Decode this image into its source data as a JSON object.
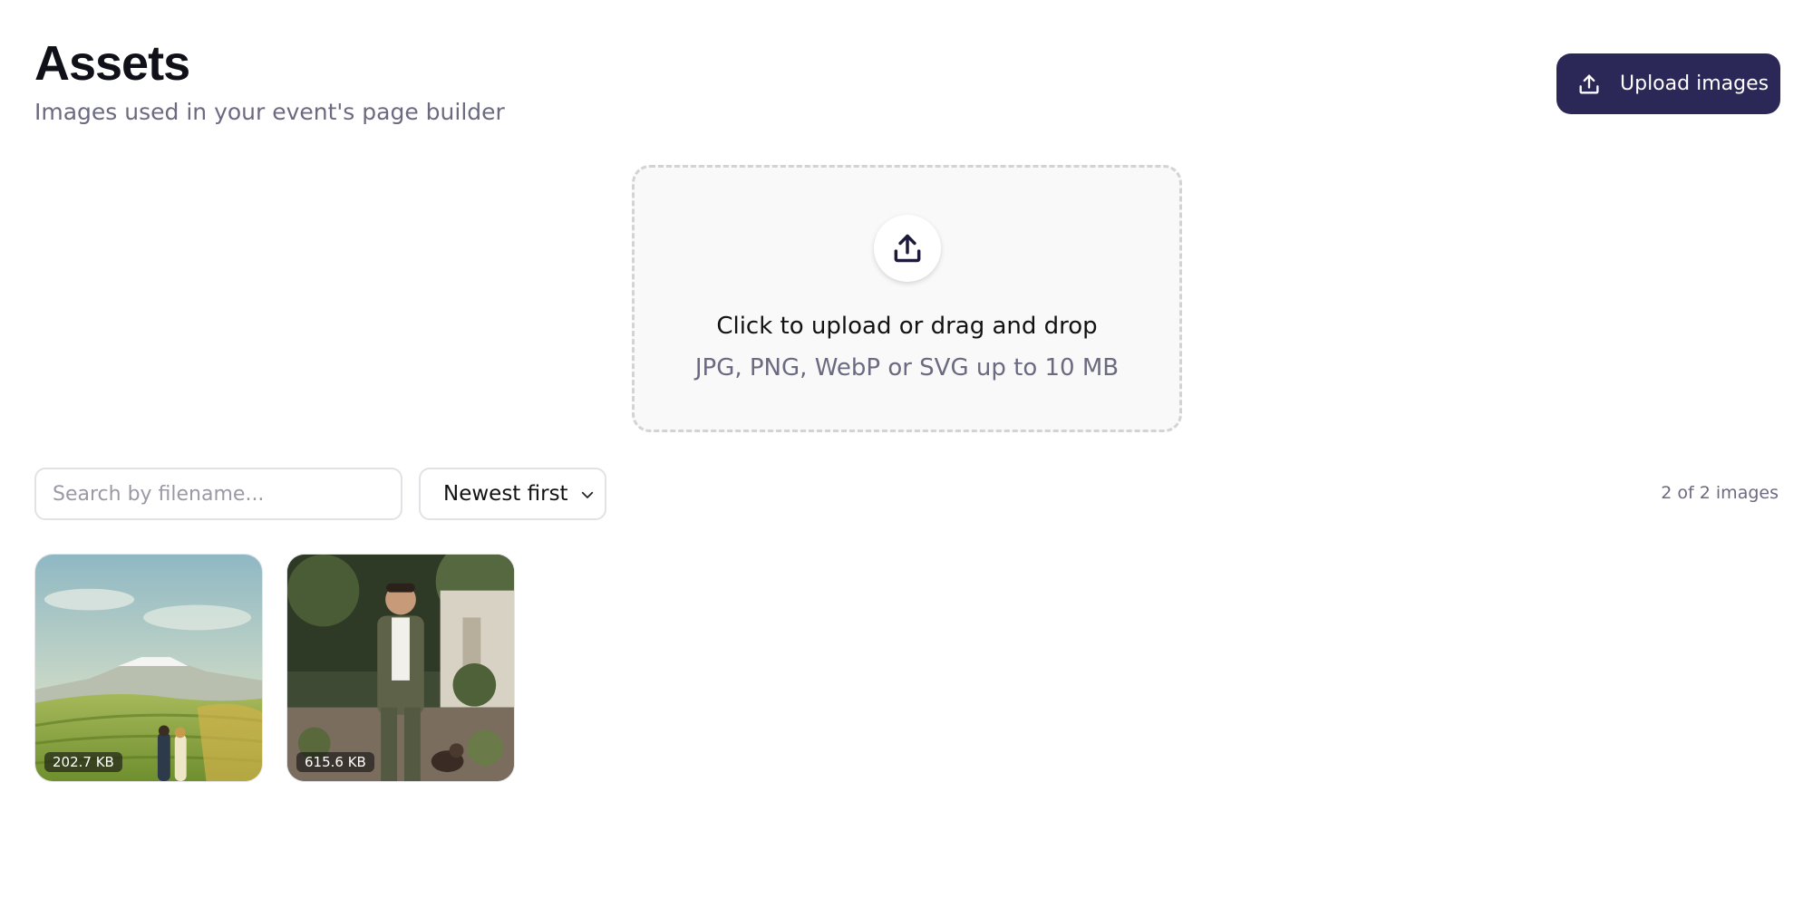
{
  "header": {
    "title": "Assets",
    "subtitle": "Images used in your event's page builder",
    "upload_button": {
      "label": "Upload images",
      "icon": "upload-icon"
    }
  },
  "dropzone": {
    "icon": "upload-icon",
    "primary_text": "Click to upload or drag and drop",
    "secondary_text": "JPG, PNG, WebP or SVG up to 10 MB"
  },
  "toolbar": {
    "search": {
      "placeholder": "Search by filename...",
      "value": ""
    },
    "sort": {
      "selected": "Newest first",
      "icon": "chevron-down-icon"
    },
    "count_text": "2 of 2 images"
  },
  "images": [
    {
      "size": "202.7 KB",
      "description": "painted-landscape"
    },
    {
      "size": "615.6 KB",
      "description": "portrait-photo"
    }
  ],
  "colors": {
    "accent": "#2b2757",
    "muted_text": "#6b6a80",
    "dropzone_bg": "#f9f9f9",
    "dropzone_border": "#d3d3d3"
  }
}
